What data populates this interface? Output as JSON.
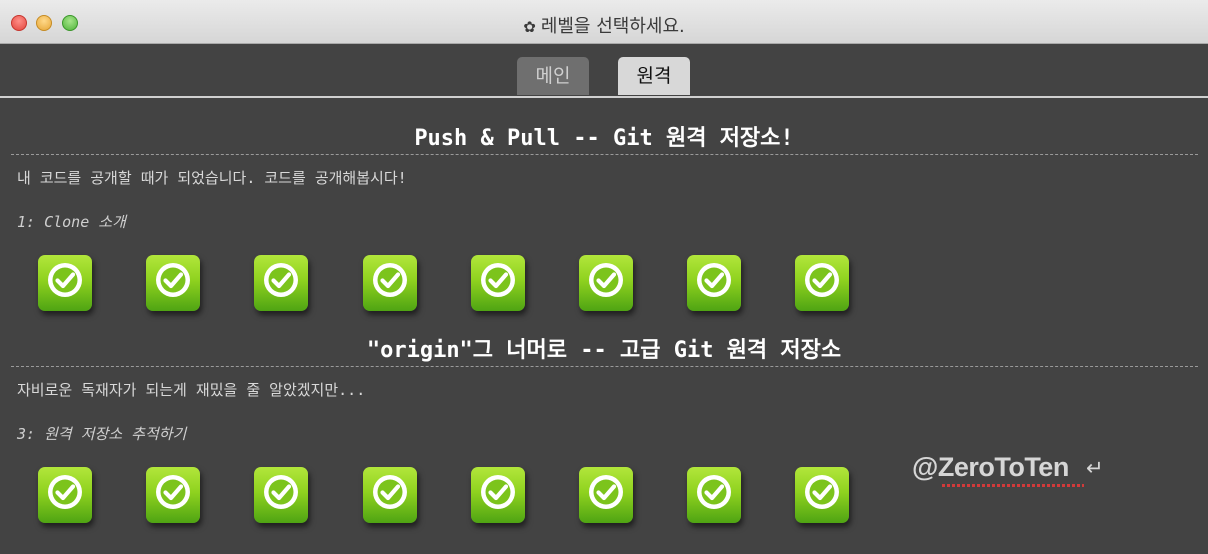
{
  "window": {
    "title": "레벨을 선택하세요.",
    "title_icon": "gear-icon"
  },
  "tabs": [
    {
      "label": "메인",
      "selected": false
    },
    {
      "label": "원격",
      "selected": true
    }
  ],
  "sections": [
    {
      "title": "Push & Pull -- Git 원격 저장소!",
      "description": "내 코드를 공개할 때가 되었습니다. 코드를 공개해봅시다!",
      "subtitle": "1: Clone 소개",
      "levels": [
        "completed",
        "completed",
        "completed",
        "completed",
        "completed",
        "completed",
        "completed",
        "completed"
      ]
    },
    {
      "title": "\"origin\"그 너머로 -- 고급 Git 원격 저장소",
      "description": "자비로운 독재자가 되는게 재밌을 줄 알았겠지만...",
      "subtitle": "3: 원격 저장소 추적하기",
      "levels": [
        "completed",
        "completed",
        "completed",
        "completed",
        "completed",
        "completed",
        "completed",
        "completed"
      ]
    }
  ],
  "watermark": {
    "text": "@ZeroToTen",
    "icon": "return-arrow-icon"
  },
  "colors": {
    "level_green": "#8fd21f",
    "background": "#434343"
  }
}
